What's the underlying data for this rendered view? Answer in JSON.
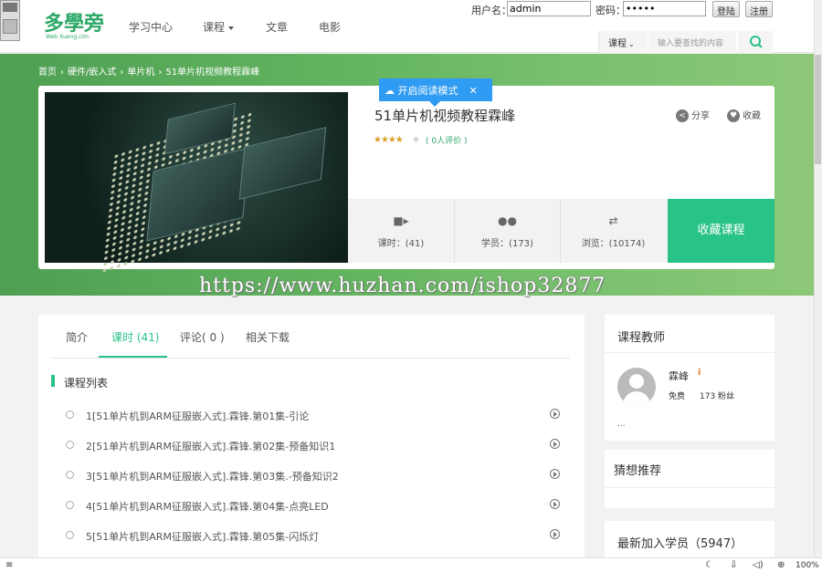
{
  "header": {
    "logo": "多學旁",
    "logo_sub": "Web Xueng.cim",
    "nav": [
      "学习中心",
      "课程",
      "文章",
      "电影"
    ],
    "login": {
      "username_label": "用户名：",
      "username_value": "admin",
      "password_label": "密码：",
      "password_value": "•••••",
      "login_btn": "登陆",
      "register_btn": "注册"
    },
    "search": {
      "category": "课程",
      "placeholder": "输入要查找的内容"
    }
  },
  "breadcrumb": [
    "首页",
    "›",
    "硬件/嵌入式",
    "›",
    "单片机",
    "›",
    "51单片机视频教程霖峰"
  ],
  "reading_mode": "开启阅读模式",
  "course": {
    "title": "51单片机视频教程霖峰",
    "stars": "★★★★",
    "star_empty": "★",
    "rating_count": "( 0人评价 )",
    "rating_value": 4,
    "share": "分享",
    "favorite": "收藏",
    "stats": [
      {
        "label": "课时：(41)",
        "icon": "video-icon"
      },
      {
        "label": "学员：(173)",
        "icon": "users-icon"
      },
      {
        "label": "浏览：(10174)",
        "icon": "arrows-icon"
      }
    ],
    "collect_btn": "收藏课程"
  },
  "watermark": "https://www.huzhan.com/ishop32877",
  "tabs": [
    "简介",
    "课时 (41)",
    "评论( 0 )",
    "相关下载"
  ],
  "list_title": "课程列表",
  "lessons": [
    "1[51单片机到ARM征服嵌入式].霖锋.第01集-引论",
    "2[51单片机到ARM征服嵌入式].霖锋.第02集-预备知识1",
    "3[51单片机到ARM征服嵌入式].霖锋.第03集.-预备知识2",
    "4[51单片机到ARM征服嵌入式].霖锋.第04集-点亮LED",
    "5[51单片机到ARM征服嵌入式].霖锋.第05集-闪烁灯"
  ],
  "sidebar": {
    "teacher_title": "课程教师",
    "teacher_name": "霖峰",
    "teacher_badge": "i",
    "teacher_free": "免费",
    "teacher_fans": "173 粉丝",
    "teacher_more": "...",
    "recommend_title": "猜想推荐",
    "students_title": "最新加入学员（5947）"
  },
  "status": {
    "zoom": "100%"
  },
  "colors": {
    "accent": "#29c287",
    "banner": "#5fb35c",
    "reading": "#2f9bf2"
  }
}
